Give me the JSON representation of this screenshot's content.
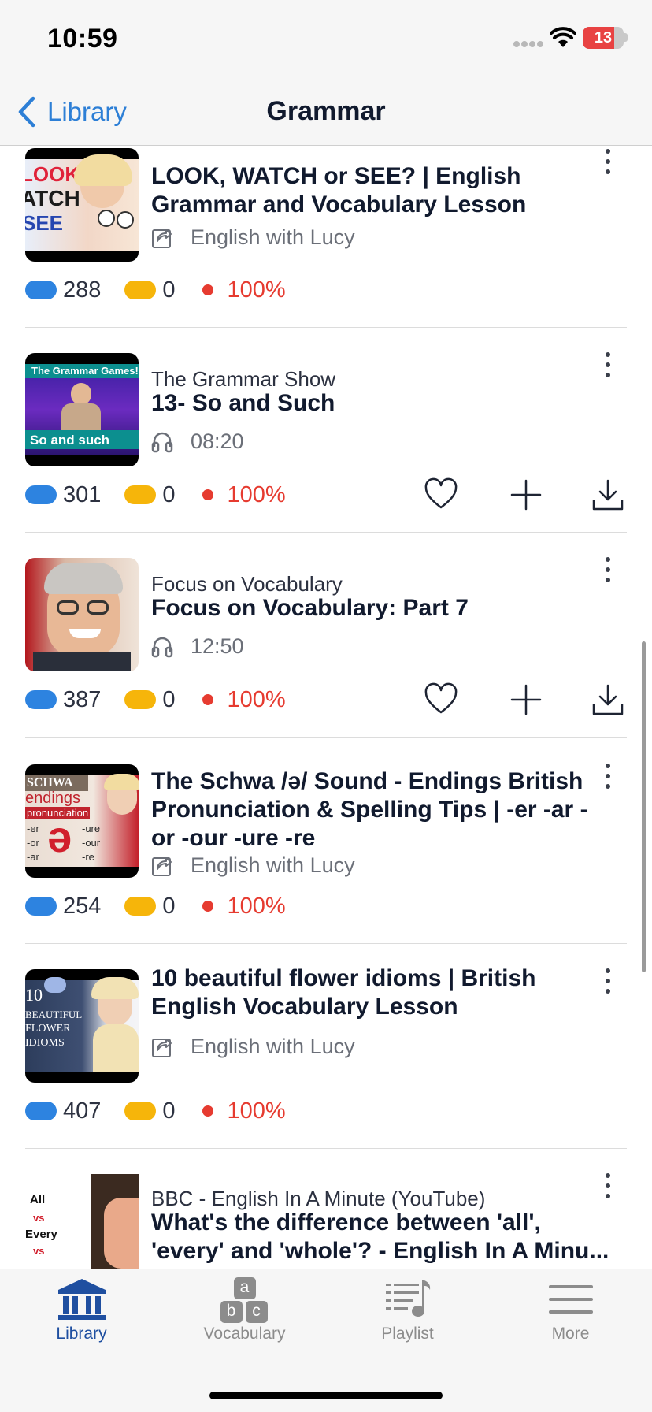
{
  "status_bar": {
    "time": "10:59",
    "battery": "13"
  },
  "nav": {
    "back_label": "Library",
    "title": "Grammar"
  },
  "items": [
    {
      "subtitle": "",
      "title": "LOOK, WATCH or SEE? | English Grammar and Vocabulary Lesson",
      "meta_icon": "channel-icon",
      "meta": "English with Lucy",
      "stat_blue": "288",
      "stat_yellow": "0",
      "stat_pct": "100%",
      "thumb_text": [
        "LOOK",
        "ATCH",
        "SEE"
      ],
      "actions": false
    },
    {
      "subtitle": "The Grammar Show",
      "title": "13- So and Such",
      "meta_icon": "headphones-icon",
      "meta": "08:20",
      "stat_blue": "301",
      "stat_yellow": "0",
      "stat_pct": "100%",
      "thumb_text": [
        "The Grammar Games!",
        "So and such"
      ],
      "actions": true
    },
    {
      "subtitle": "Focus on Vocabulary",
      "title": "Focus on Vocabulary: Part 7",
      "meta_icon": "headphones-icon",
      "meta": "12:50",
      "stat_blue": "387",
      "stat_yellow": "0",
      "stat_pct": "100%",
      "thumb_text": [],
      "actions": true
    },
    {
      "subtitle": "",
      "title": "The Schwa /ə/ Sound - Endings British Pronunciation & Spelling Tips | -er -ar -or -our -ure -re",
      "meta_icon": "channel-icon",
      "meta": "English with Lucy",
      "stat_blue": "254",
      "stat_yellow": "0",
      "stat_pct": "100%",
      "thumb_text": [
        "SCHWA",
        "endings",
        "pronunciation",
        "ə",
        "-er",
        "-or",
        "-ar",
        "-ure",
        "-our",
        "-re"
      ],
      "actions": false
    },
    {
      "subtitle": "",
      "title": "10 beautiful flower idioms | British English Vocabulary Lesson",
      "meta_icon": "channel-icon",
      "meta": "English with Lucy",
      "stat_blue": "407",
      "stat_yellow": "0",
      "stat_pct": "100%",
      "thumb_text": [
        "10",
        "BEAUTIFUL",
        "FLOWER",
        "IDIOMS"
      ],
      "actions": false
    },
    {
      "subtitle": "BBC - English In A Minute (YouTube)",
      "title": "What's the difference between 'all', 'every' and 'whole'? - English In A Minu...",
      "meta_icon": "",
      "meta": "",
      "thumb_text": [
        "All",
        "vs",
        "Every",
        "vs"
      ],
      "actions": false
    }
  ],
  "tabs": [
    {
      "label": "Library",
      "icon": "library-icon",
      "active": true
    },
    {
      "label": "Vocabulary",
      "icon": "vocabulary-icon",
      "active": false,
      "icon_letters": [
        "a",
        "b",
        "c"
      ]
    },
    {
      "label": "Playlist",
      "icon": "playlist-icon",
      "active": false
    },
    {
      "label": "More",
      "icon": "menu-icon",
      "active": false
    }
  ],
  "colors": {
    "accent": "#2d7fd6",
    "tab_active": "#1f4fa0",
    "stat_blue": "#2d83e0",
    "stat_yellow": "#f6b50a",
    "stat_red": "#e63b30"
  }
}
